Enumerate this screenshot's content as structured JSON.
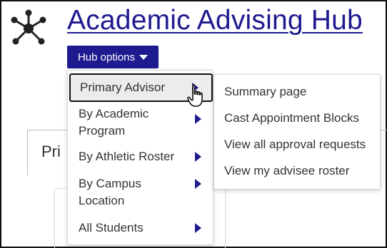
{
  "app": {
    "title": "Academic Advising Hub",
    "logo_icon": "network-hub-icon"
  },
  "toolbar": {
    "hub_options_label": "Hub options",
    "hub_options_icon": "caret-down-icon"
  },
  "background": {
    "tab_partial_text": "Pri"
  },
  "menu": {
    "items": [
      {
        "label": "Primary Advisor",
        "active": true,
        "has_submenu": true
      },
      {
        "label": "By Academic\nProgram",
        "has_submenu": true
      },
      {
        "label": "By Athletic Roster",
        "has_submenu": true
      },
      {
        "label": "By Campus\nLocation",
        "has_submenu": true
      },
      {
        "label": "All Students",
        "has_submenu": true
      }
    ]
  },
  "submenu": {
    "items": [
      {
        "label": "Summary page"
      },
      {
        "label": "Cast Appointment Blocks"
      },
      {
        "label": "View all approval requests"
      },
      {
        "label": "View my advisee roster"
      }
    ]
  },
  "colors": {
    "brand": "#1e1a8f",
    "active_item_bg": "#ececec"
  }
}
